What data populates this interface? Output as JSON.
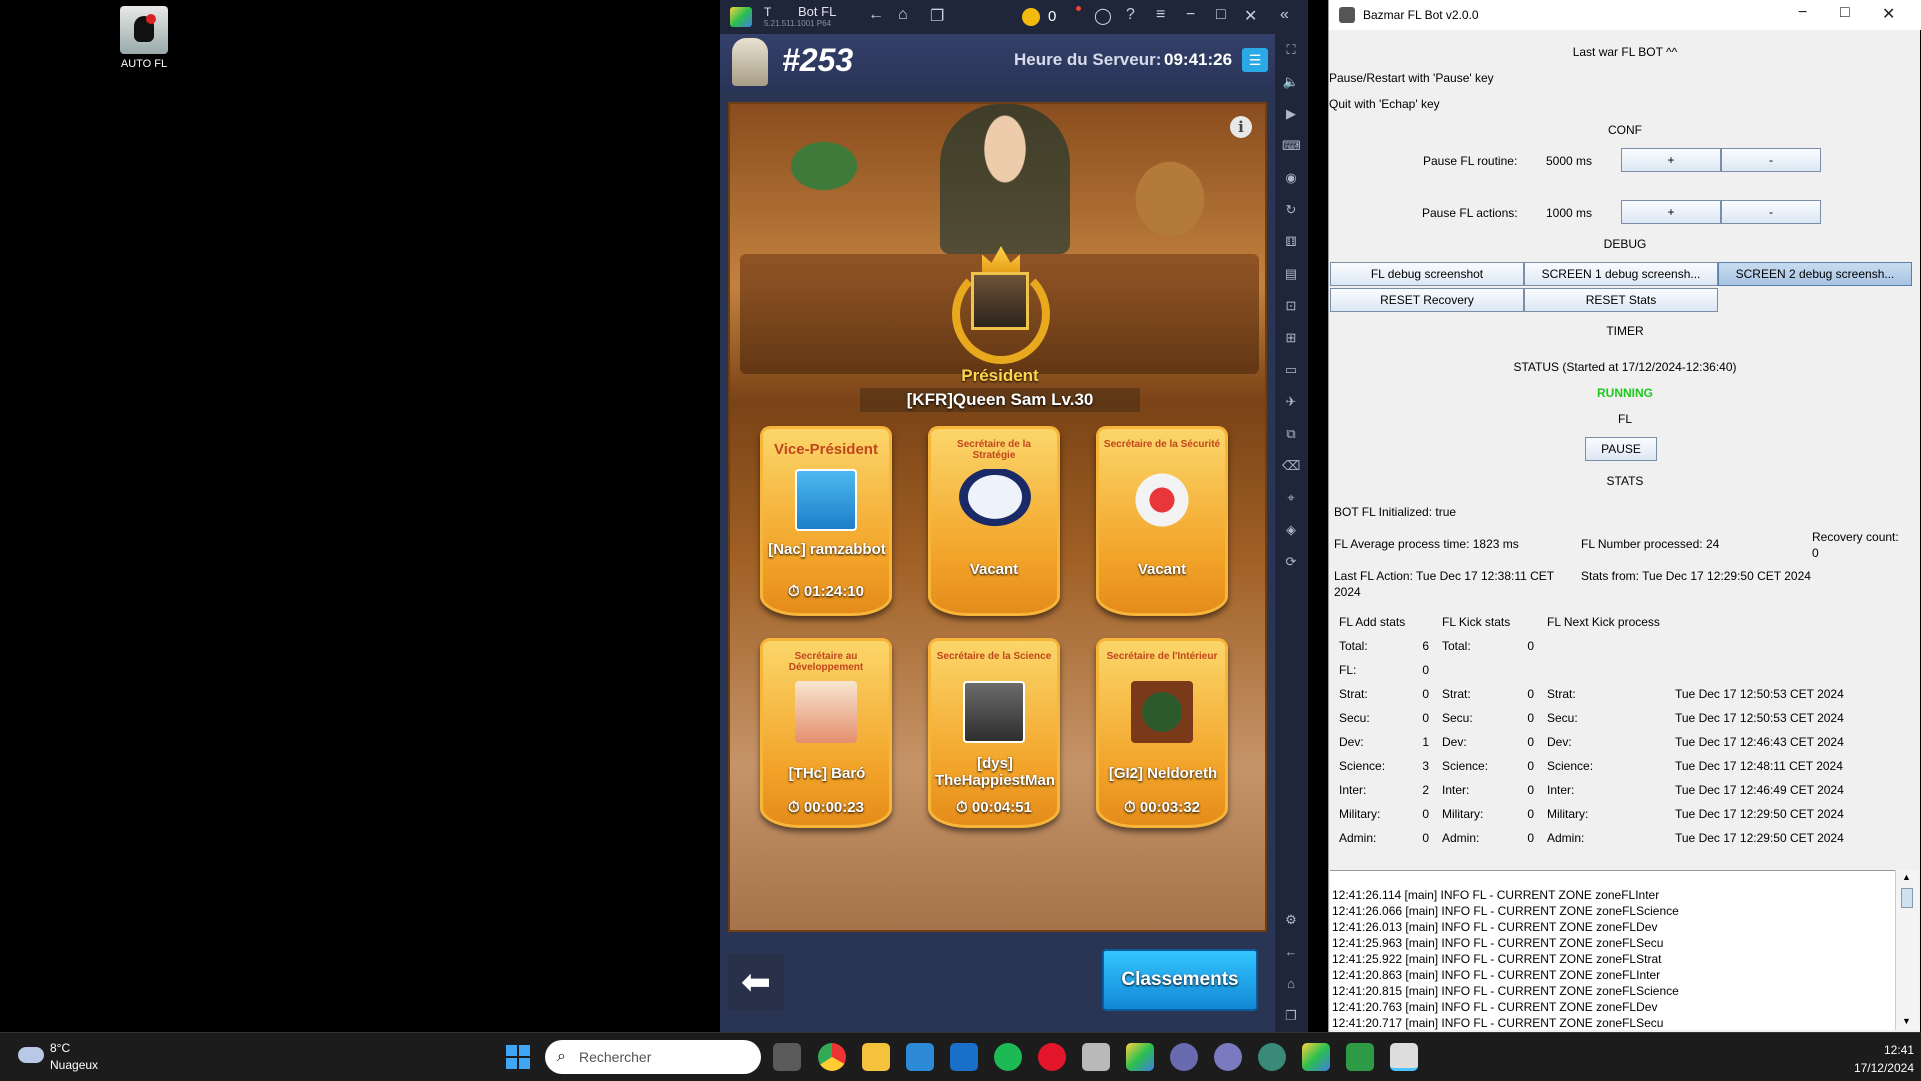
{
  "desktop": {
    "icon_label": "AUTO FL"
  },
  "emulator": {
    "tab_letter": "T",
    "window_title": "Bot FL",
    "version": "5.21.511.1001 P64",
    "coins": "0"
  },
  "game": {
    "server_number": "#253",
    "server_time_label": "Heure du Serveur:",
    "server_time": "09:41:26",
    "president": {
      "title": "Président",
      "name": "[KFR]Queen Sam Lv.30"
    },
    "cards": [
      {
        "title": "Vice-Président",
        "name": "[Nac] ramzabbot",
        "time": "01:24:10",
        "vacant": ""
      },
      {
        "title": "Secrétaire de la Stratégie",
        "name": "",
        "time": "",
        "vacant": "Vacant"
      },
      {
        "title": "Secrétaire de la Sécurité",
        "name": "",
        "time": "",
        "vacant": "Vacant"
      },
      {
        "title": "Secrétaire au Développement",
        "name": "[THc] Baró",
        "time": "00:00:23",
        "vacant": ""
      },
      {
        "title": "Secrétaire de la Science",
        "name": "[dys] TheHappiestMan",
        "time": "00:04:51",
        "vacant": ""
      },
      {
        "title": "Secrétaire de l'Intérieur",
        "name": "[GI2] Neldoreth",
        "time": "00:03:32",
        "vacant": ""
      }
    ],
    "rankings_button": "Classements"
  },
  "bot": {
    "window_title": "Bazmar FL Bot v2.0.0",
    "heading": "Last war FL BOT ^^",
    "hint_pause": "Pause/Restart with 'Pause' key",
    "hint_quit": "Quit with 'Echap' key",
    "conf_label": "CONF",
    "pause_routine_label": "Pause FL routine:",
    "pause_routine_value": "5000 ms",
    "pause_actions_label": "Pause FL actions:",
    "pause_actions_value": "1000 ms",
    "plus": "+",
    "minus": "-",
    "debug_label": "DEBUG",
    "btn_fl_debug": "FL debug screenshot",
    "btn_screen1": "SCREEN 1 debug screensh...",
    "btn_screen2": "SCREEN 2 debug screensh...",
    "btn_reset_recovery": "RESET Recovery",
    "btn_reset_stats": "RESET Stats",
    "timer_label": "TIMER",
    "status_label": "STATUS (Started at 17/12/2024-12:36:40)",
    "status_value": "RUNNING",
    "fl_label": "FL",
    "pause_button": "PAUSE",
    "stats_label": "STATS",
    "initialized": "BOT FL Initialized: true",
    "avg_time": "FL Average process time: 1823 ms",
    "number_processed": "FL Number processed: 24",
    "recovery_count": "Recovery count:",
    "recovery_value": "0",
    "last_action": "Last FL Action: Tue Dec 17 12:38:11 CET 2024",
    "stats_from": "Stats from: Tue Dec 17 12:29:50 CET 2024",
    "add_header": "FL Add stats",
    "kick_header": "FL Kick stats",
    "next_header": "FL Next Kick process",
    "add_rows": [
      {
        "k": "Total:",
        "v": "6"
      },
      {
        "k": "FL:",
        "v": "0"
      },
      {
        "k": "Strat:",
        "v": "0"
      },
      {
        "k": "Secu:",
        "v": "0"
      },
      {
        "k": "Dev:",
        "v": "1"
      },
      {
        "k": "Science:",
        "v": "3"
      },
      {
        "k": "Inter:",
        "v": "2"
      },
      {
        "k": "Military:",
        "v": "0"
      },
      {
        "k": "Admin:",
        "v": "0"
      }
    ],
    "kick_rows": [
      {
        "k": "Total:",
        "v": "0"
      },
      {
        "k": "",
        "v": ""
      },
      {
        "k": "Strat:",
        "v": "0"
      },
      {
        "k": "Secu:",
        "v": "0"
      },
      {
        "k": "Dev:",
        "v": "0"
      },
      {
        "k": "Science:",
        "v": "0"
      },
      {
        "k": "Inter:",
        "v": "0"
      },
      {
        "k": "Military:",
        "v": "0"
      },
      {
        "k": "Admin:",
        "v": "0"
      }
    ],
    "next_rows": [
      {
        "k": "",
        "v": ""
      },
      {
        "k": "",
        "v": ""
      },
      {
        "k": "Strat:",
        "v": "Tue Dec 17 12:50:53 CET 2024"
      },
      {
        "k": "Secu:",
        "v": "Tue Dec 17 12:50:53 CET 2024"
      },
      {
        "k": "Dev:",
        "v": "Tue Dec 17 12:46:43 CET 2024"
      },
      {
        "k": "Science:",
        "v": "Tue Dec 17 12:48:11 CET 2024"
      },
      {
        "k": "Inter:",
        "v": "Tue Dec 17 12:46:49 CET 2024"
      },
      {
        "k": "Military:",
        "v": "Tue Dec 17 12:29:50 CET 2024"
      },
      {
        "k": "Admin:",
        "v": "Tue Dec 17 12:29:50 CET 2024"
      }
    ],
    "log_lines": [
      "12:41:26.114 [main] INFO  FL - CURRENT ZONE zoneFLInter",
      "12:41:26.066 [main] INFO  FL - CURRENT ZONE zoneFLScience",
      "12:41:26.013 [main] INFO  FL - CURRENT ZONE zoneFLDev",
      "12:41:25.963 [main] INFO  FL - CURRENT ZONE zoneFLSecu",
      "12:41:25.922 [main] INFO  FL - CURRENT ZONE zoneFLStrat",
      "12:41:20.863 [main] INFO  FL - CURRENT ZONE zoneFLInter",
      "12:41:20.815 [main] INFO  FL - CURRENT ZONE zoneFLScience",
      "12:41:20.763 [main] INFO  FL - CURRENT ZONE zoneFLDev",
      "12:41:20.717 [main] INFO  FL - CURRENT ZONE zoneFLSecu"
    ]
  },
  "taskbar": {
    "temperature": "8°C",
    "weather": "Nuageux",
    "search_placeholder": "Rechercher",
    "time": "12:41",
    "date": "17/12/2024"
  },
  "colors": {
    "running": "#1ec81e",
    "accent": "#3fa6f5"
  }
}
